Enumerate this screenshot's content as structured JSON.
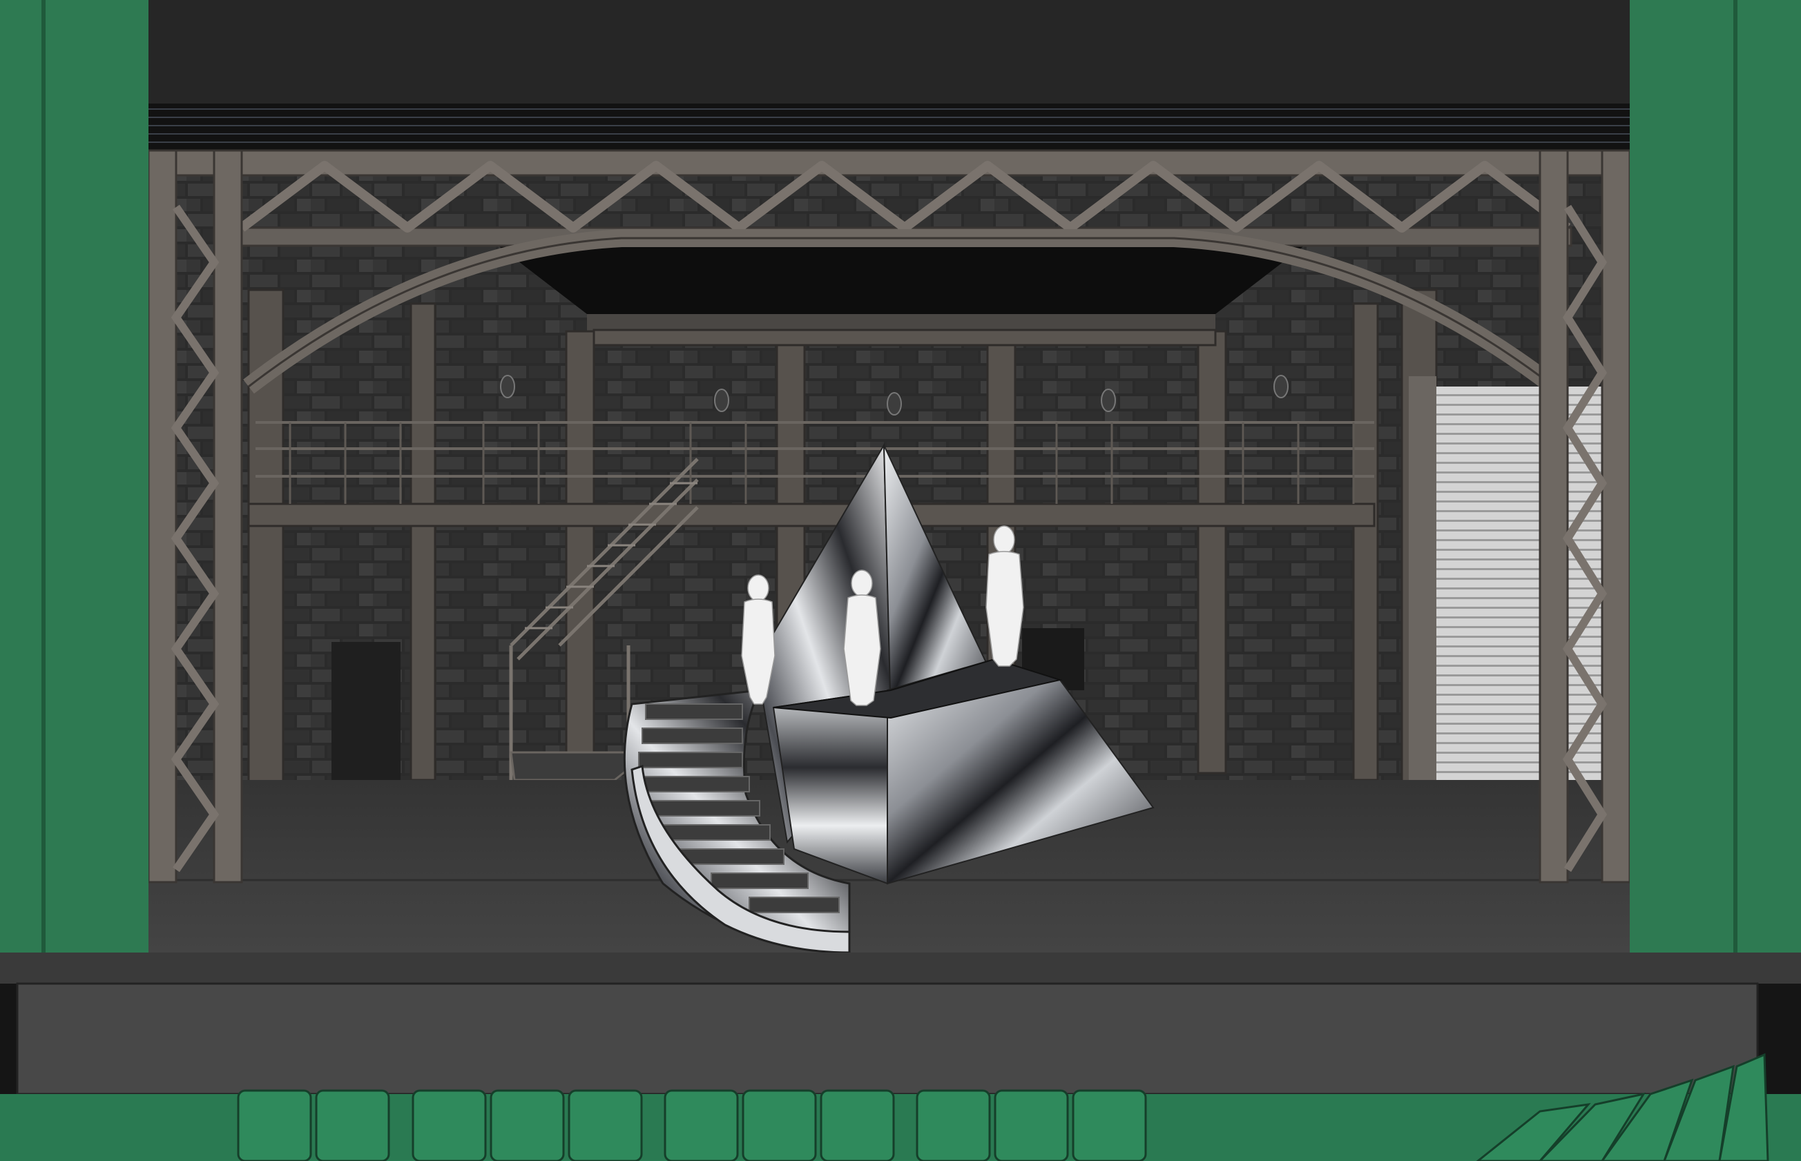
{
  "scene": {
    "palette": {
      "proscenium_green": "#2e7a52",
      "proscenium_green_dark": "#1f5a3b",
      "seat_green": "#2f8a5c",
      "truss_steel": "#6e6862",
      "truss_edge": "#3a3633",
      "brick_dark": "#2a2a2a",
      "brick_mortar": "#474747",
      "deck": "#3b3b3b",
      "apron": "#4a4a4a",
      "marble_light": "#e9eaec",
      "marble_dark": "#1c1d20",
      "figure_white": "#f3f3f3",
      "shutter": "#cfcfcf"
    },
    "elements": [
      "proscenium-left",
      "proscenium-right",
      "overhead-truss",
      "brick-back-wall",
      "mezzanine-walkway",
      "staircase",
      "roller-shutter",
      "marble-pyramid",
      "spiral-staircase",
      "figure-left",
      "figure-center",
      "figure-right",
      "stage-deck",
      "apron-front",
      "audience-seats"
    ]
  }
}
